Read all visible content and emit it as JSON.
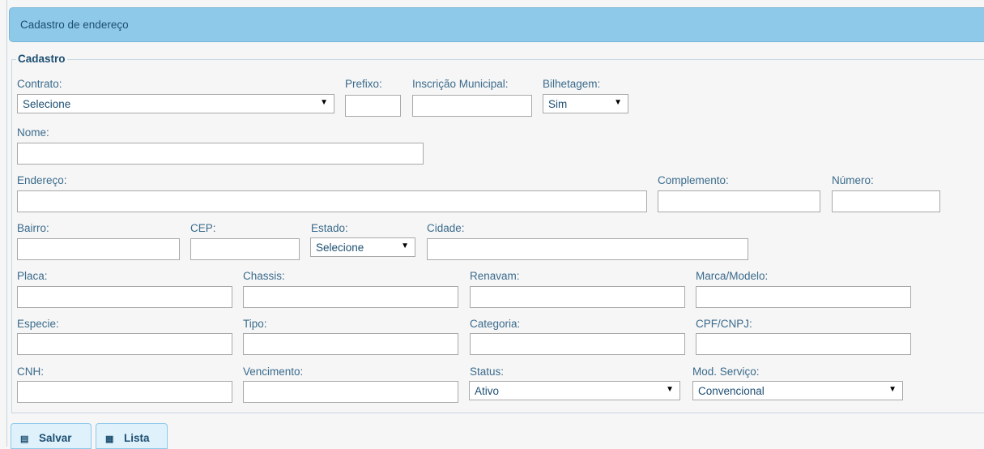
{
  "header": {
    "title": "Cadastro de endereço"
  },
  "fieldset": {
    "legend": "Cadastro"
  },
  "fields": {
    "contrato": {
      "label": "Contrato:",
      "value": "Selecione"
    },
    "prefixo": {
      "label": "Prefixo:"
    },
    "inscricao": {
      "label": "Inscrição Municipal:"
    },
    "bilhetagem": {
      "label": "Bilhetagem:",
      "value": "Sim"
    },
    "nome": {
      "label": "Nome:"
    },
    "endereco": {
      "label": "Endereço:"
    },
    "complemento": {
      "label": "Complemento:"
    },
    "numero": {
      "label": "Número:"
    },
    "bairro": {
      "label": "Bairro:"
    },
    "cep": {
      "label": "CEP:"
    },
    "estado": {
      "label": "Estado:",
      "value": "Selecione"
    },
    "cidade": {
      "label": "Cidade:"
    },
    "placa": {
      "label": "Placa:"
    },
    "chassis": {
      "label": "Chassis:"
    },
    "renavam": {
      "label": "Renavam:"
    },
    "marca_modelo": {
      "label": "Marca/Modelo:"
    },
    "especie": {
      "label": "Especie:"
    },
    "tipo": {
      "label": "Tipo:"
    },
    "categoria": {
      "label": "Categoria:"
    },
    "cpf_cnpj": {
      "label": "CPF/CNPJ:"
    },
    "cnh": {
      "label": "CNH:"
    },
    "vencimento": {
      "label": "Vencimento:"
    },
    "status": {
      "label": "Status:",
      "value": "Ativo"
    },
    "mod_servico": {
      "label": "Mod. Serviço:",
      "value": "Convencional"
    }
  },
  "buttons": {
    "salvar": {
      "label": "Salvar",
      "icon": "save-icon"
    },
    "lista": {
      "label": "Lista",
      "icon": "list-icon"
    }
  },
  "colors": {
    "header_bg": "#8ec9ea",
    "label_text": "#3a6b8c",
    "accent_dark": "#1d4f72"
  }
}
